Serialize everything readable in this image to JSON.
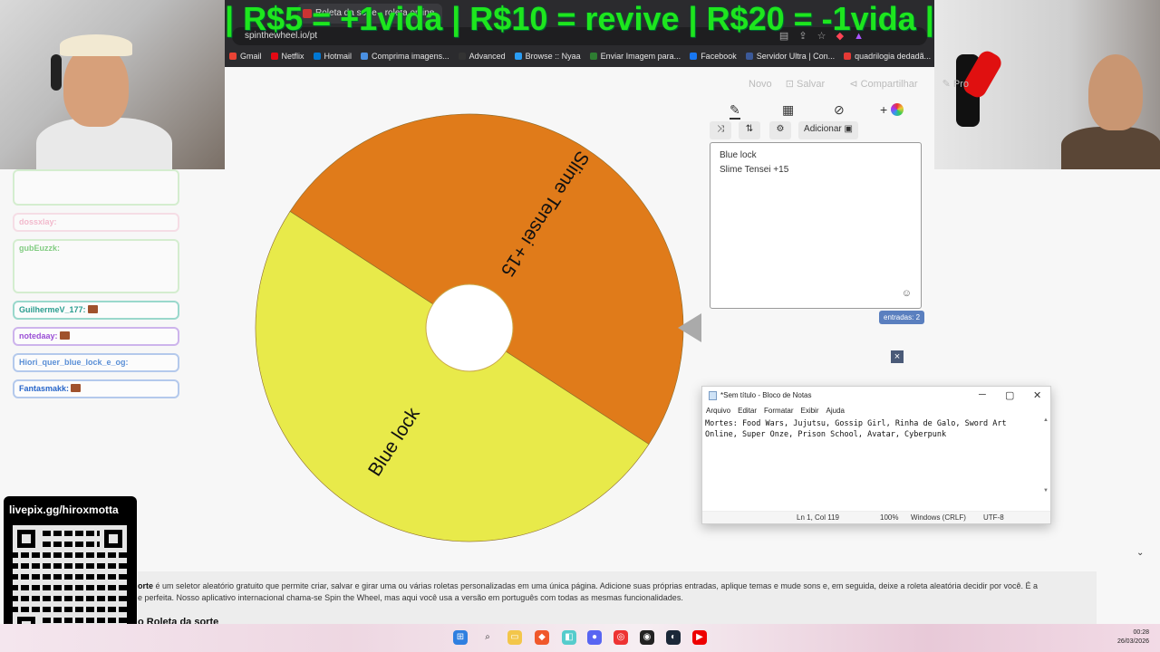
{
  "banner": "| R$5 = +1vida | R$10 = revive | R$20 = -1vida |",
  "browser": {
    "tab_title": "Roleta da sorte - roleta online",
    "tab_close": "×",
    "url": "spinthewheel.io/pt",
    "bookmarks": [
      "Gmail",
      "Netflix",
      "Hotmail",
      "Comprima imagens...",
      "Advanced",
      "Browse :: Nyaa",
      "Enviar Imagem para...",
      "Facebook",
      "Servidor Ultra | Con...",
      "quadrilogia dedadã..."
    ],
    "bookmark_colors": [
      "#ea4335",
      "#e50914",
      "#0078d4",
      "#4a90e2",
      "#333333",
      "#2a9df4",
      "#2e7d32",
      "#1877f2",
      "#3b5998",
      "#e53935"
    ]
  },
  "chat": {
    "messages": [
      {
        "user": "",
        "text": "",
        "style": "faded tall"
      },
      {
        "user": "dossxlay:",
        "text": "",
        "style": "faded pink"
      },
      {
        "user": "gubEuzzk:",
        "text": "",
        "style": "faded tall2"
      },
      {
        "user": "GuilhermeV_177:",
        "text": "",
        "style": "teal"
      },
      {
        "user": "notedaay:",
        "text": "",
        "style": "purple"
      },
      {
        "user": "Hiori_quer_blue_lock_e_og:",
        "text": "",
        "style": "blue"
      },
      {
        "user": "Fantasmakk:",
        "text": "",
        "style": "navy"
      }
    ]
  },
  "livepix": {
    "label": "livepix.gg/hiroxmotta"
  },
  "page": {
    "top_actions": [
      "Novo",
      "Salvar",
      "Compartilhar",
      "Pro"
    ],
    "add_label": "Adicionar",
    "entries": [
      "Blue lock",
      "Slime Tensei +15"
    ],
    "entries_count": "entradas: 2",
    "close_symbol": "×",
    "description_bold": "orte",
    "description": " é um seletor aleatório gratuito que permite criar, salvar e girar uma ou várias roletas personalizadas em uma única página. Adicione suas próprias entradas, aplique temas e mude sons e, em seguida, deixe a roleta aleatória decidir por você. É a",
    "description_2": "e perfeita. Nosso aplicativo internacional chama-se Spin the Wheel, mas aqui você usa a versão em português com todas as mesmas funcionalidades.",
    "description_heading": "o Roleta da sorte",
    "chevron": "⌄"
  },
  "wheel": {
    "segments": [
      {
        "label": "Slime Tensei +15",
        "color": "#e07b1a"
      },
      {
        "label": "Blue lock",
        "color": "#e8ea4a"
      }
    ]
  },
  "notepad": {
    "title": "*Sem título - Bloco de Notas",
    "menu": [
      "Arquivo",
      "Editar",
      "Formatar",
      "Exibir",
      "Ajuda"
    ],
    "text": "Mortes: Food Wars, Jujutsu, Gossip Girl, Rinha de Galo, Sword Art Online, Super Onze, Prison School, Avatar, Cyberpunk",
    "status_pos": "Ln 1, Col 119",
    "status_zoom": "100%",
    "status_eol": "Windows (CRLF)",
    "status_enc": "UTF-8",
    "btn_min": "─",
    "btn_max": "▢",
    "btn_close": "✕"
  },
  "taskbar": {
    "time": "00:28",
    "date": "26/03/2026"
  }
}
